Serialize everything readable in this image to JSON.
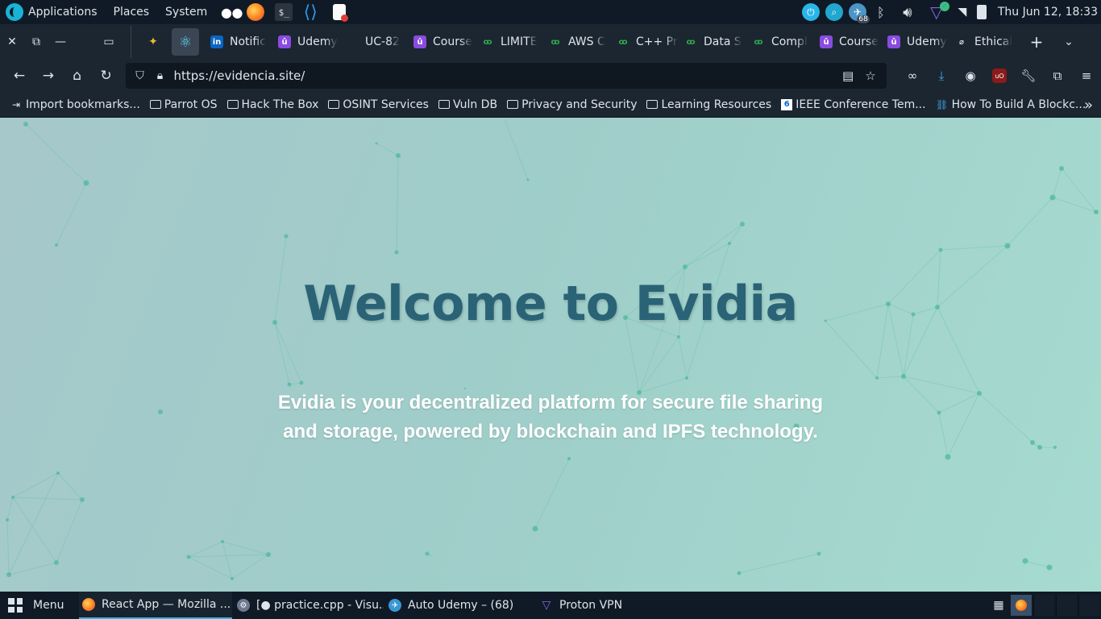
{
  "os_panel": {
    "menus": [
      "Applications",
      "Places",
      "System"
    ],
    "clock": "Thu Jun 12, 18:33",
    "telegram_badge": "68"
  },
  "tabs": [
    {
      "icon": "linkedin-icon",
      "label": "Notific"
    },
    {
      "icon": "udemy-icon",
      "label": "Udemy"
    },
    {
      "icon": "blank-icon",
      "label": "UC-82"
    },
    {
      "icon": "udemy-icon",
      "label": "Course"
    },
    {
      "icon": "gfg-icon",
      "label": "LIMITE"
    },
    {
      "icon": "gfg-icon",
      "label": "AWS C"
    },
    {
      "icon": "gfg-icon",
      "label": "C++ Pr"
    },
    {
      "icon": "gfg-icon",
      "label": "Data S"
    },
    {
      "icon": "gfg-icon",
      "label": "Compl"
    },
    {
      "icon": "udemy-icon",
      "label": "Course"
    },
    {
      "icon": "udemy-icon",
      "label": "Udemy"
    },
    {
      "icon": "ethical-icon",
      "label": "Ethical"
    }
  ],
  "navbar": {
    "url": "https://evidencia.site/"
  },
  "bookmarks": [
    {
      "icon": "import-icon",
      "label": "Import bookmarks..."
    },
    {
      "icon": "folder-icon",
      "label": "Parrot OS"
    },
    {
      "icon": "folder-icon",
      "label": "Hack The Box"
    },
    {
      "icon": "folder-icon",
      "label": "OSINT Services"
    },
    {
      "icon": "folder-icon",
      "label": "Vuln DB"
    },
    {
      "icon": "folder-icon",
      "label": "Privacy and Security"
    },
    {
      "icon": "folder-icon",
      "label": "Learning Resources"
    },
    {
      "icon": "ieee-icon",
      "label": "IEEE Conference Tem..."
    },
    {
      "icon": "chain-icon",
      "label": "How To Build A Blockc..."
    }
  ],
  "hero": {
    "title": "Welcome to Evidia",
    "subtitle_line1": "Evidia is your decentralized platform for secure file sharing",
    "subtitle_line2": "and storage, powered by blockchain and IPFS technology."
  },
  "taskbar": {
    "menu_label": "Menu",
    "tasks": [
      {
        "label": "React App — Mozilla ...",
        "active": true
      },
      {
        "label": "[● practice.cpp - Visu...",
        "active": false
      },
      {
        "label": "Auto Udemy – (68)",
        "active": false
      },
      {
        "label": "Proton VPN",
        "active": false
      }
    ]
  },
  "colors": {
    "title": "#2a6276",
    "accent": "#3ab0e0",
    "network": "#52b89c"
  }
}
